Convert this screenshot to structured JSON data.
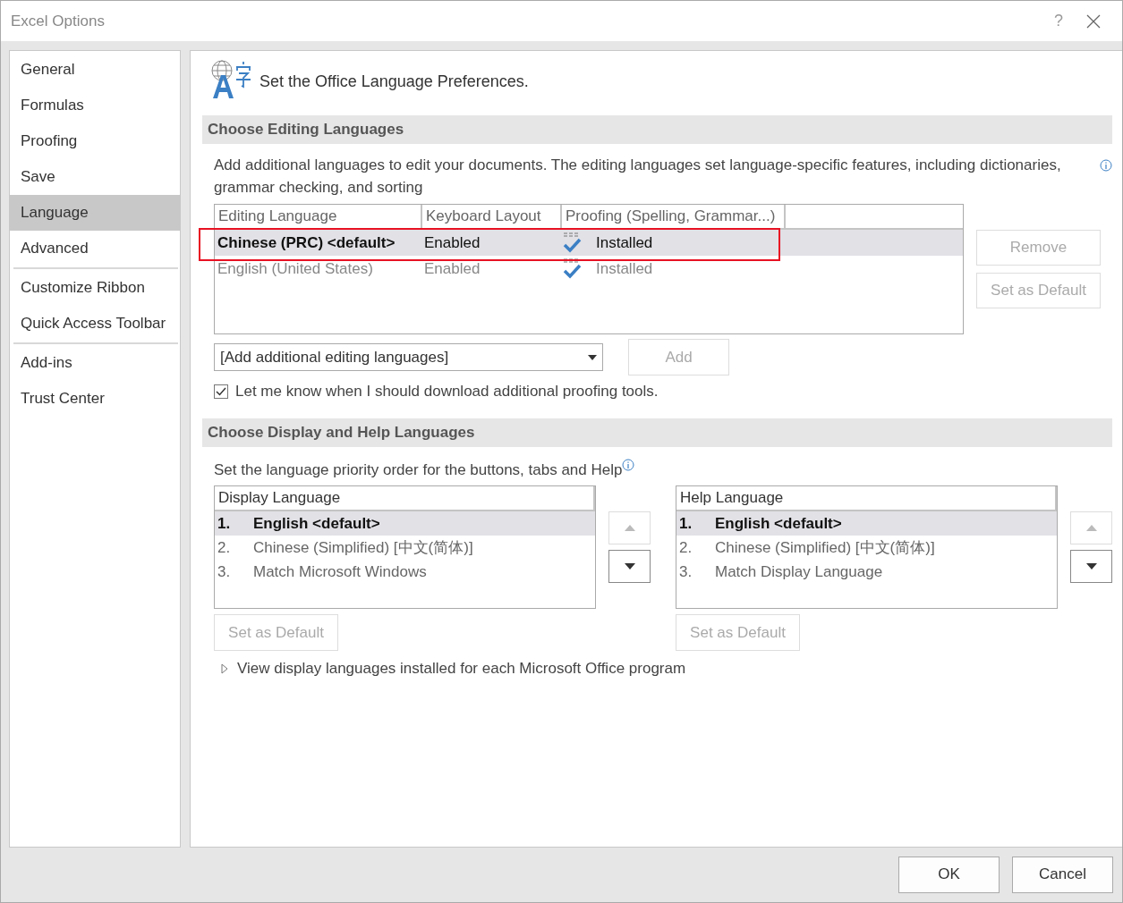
{
  "window": {
    "title": "Excel Options",
    "help": "?"
  },
  "sidebar": {
    "groups": [
      [
        {
          "label": "General",
          "selected": false
        },
        {
          "label": "Formulas",
          "selected": false
        },
        {
          "label": "Proofing",
          "selected": false
        },
        {
          "label": "Save",
          "selected": false
        },
        {
          "label": "Language",
          "selected": true
        },
        {
          "label": "Advanced",
          "selected": false
        }
      ],
      [
        {
          "label": "Customize Ribbon",
          "selected": false
        },
        {
          "label": "Quick Access Toolbar",
          "selected": false
        }
      ],
      [
        {
          "label": "Add-ins",
          "selected": false
        },
        {
          "label": "Trust Center",
          "selected": false
        }
      ]
    ]
  },
  "heading": "Set the Office Language Preferences.",
  "editing": {
    "title": "Choose Editing Languages",
    "intro": "Add additional languages to edit your documents. The editing languages set language-specific features, including dictionaries, grammar checking, and sorting",
    "columns": [
      "Editing Language",
      "Keyboard Layout",
      "Proofing (Spelling, Grammar...)"
    ],
    "rows": [
      {
        "language": "Chinese (PRC) <default>",
        "keyboard": "Enabled",
        "proofing": "Installed",
        "selected": true
      },
      {
        "language": "English (United States)",
        "keyboard": "Enabled",
        "proofing": "Installed",
        "selected": false
      }
    ],
    "annotations": [
      {
        "kind": "rectangle"
      }
    ],
    "buttons": [
      {
        "label": "Remove",
        "disabled": true
      },
      {
        "label": "Set as Default",
        "disabled": true
      }
    ],
    "dropdown": {
      "value": "[Add additional editing languages]"
    },
    "add_button": {
      "label": "Add",
      "disabled": true
    },
    "checkbox": {
      "label": "Let me know when I should download additional proofing tools.",
      "checked": true
    }
  },
  "display": {
    "title": "Choose Display and Help Languages",
    "intro": "Set the language priority order for the buttons, tabs and Help",
    "lists": [
      {
        "header": "Display Language",
        "items": [
          {
            "number": "1.",
            "label": "English <default>",
            "selected": true
          },
          {
            "number": "2.",
            "label": "Chinese (Simplified) [中文(简体)]",
            "selected": false
          },
          {
            "number": "3.",
            "label": "Match Microsoft Windows",
            "selected": false
          }
        ],
        "up_disabled": true,
        "down_disabled": false,
        "button": {
          "label": "Set as Default",
          "disabled": true
        }
      },
      {
        "header": "Help Language",
        "items": [
          {
            "number": "1.",
            "label": "English <default>",
            "selected": true
          },
          {
            "number": "2.",
            "label": "Chinese (Simplified) [中文(简体)]",
            "selected": false
          },
          {
            "number": "3.",
            "label": "Match Display Language",
            "selected": false
          }
        ],
        "up_disabled": true,
        "down_disabled": false,
        "button": {
          "label": "Set as Default",
          "disabled": true
        }
      }
    ],
    "expander": {
      "label": "View display languages installed for each Microsoft Office program",
      "expanded": false
    }
  },
  "footer": {
    "buttons": [
      "OK",
      "Cancel"
    ]
  }
}
